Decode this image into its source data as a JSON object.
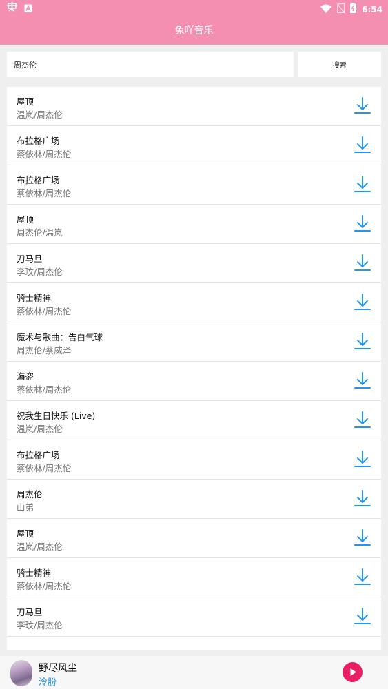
{
  "status_bar": {
    "time": "6:54",
    "left_icons": [
      "bug-icon",
      "a-badge-icon"
    ],
    "right_icons": [
      "wifi-icon",
      "no-sim-icon",
      "battery-icon"
    ]
  },
  "header": {
    "title": "兔吖音乐",
    "color": "#f48fb1"
  },
  "search": {
    "value": "周杰伦",
    "button_label": "搜索"
  },
  "results": [
    {
      "title": "屋顶",
      "artist": "温岚/周杰伦"
    },
    {
      "title": "布拉格广场",
      "artist": "蔡依林/周杰伦"
    },
    {
      "title": "布拉格广场",
      "artist": "蔡依林/周杰伦"
    },
    {
      "title": "屋顶",
      "artist": "周杰伦/温岚"
    },
    {
      "title": "刀马旦",
      "artist": "李玟/周杰伦"
    },
    {
      "title": "骑士精神",
      "artist": "蔡依林/周杰伦"
    },
    {
      "title": "魔术与歌曲：告白气球",
      "artist": "周杰伦/蔡威泽"
    },
    {
      "title": "海盗",
      "artist": "蔡依林/周杰伦"
    },
    {
      "title": "祝我生日快乐 (Live)",
      "artist": "温岚/周杰伦"
    },
    {
      "title": "布拉格广场",
      "artist": "蔡依林/周杰伦"
    },
    {
      "title": "周杰伦",
      "artist": "山弟"
    },
    {
      "title": "屋顶",
      "artist": "温岚/周杰伦"
    },
    {
      "title": "骑士精神",
      "artist": "蔡依林/周杰伦"
    },
    {
      "title": "刀马旦",
      "artist": "李玟/周杰伦"
    }
  ],
  "download_icon": "download-icon",
  "download_color": "#2196f3",
  "now_playing": {
    "title": "野尽风尘",
    "artist": "泠朌",
    "artist_color": "#2196f3",
    "play_color": "#e91e63"
  }
}
